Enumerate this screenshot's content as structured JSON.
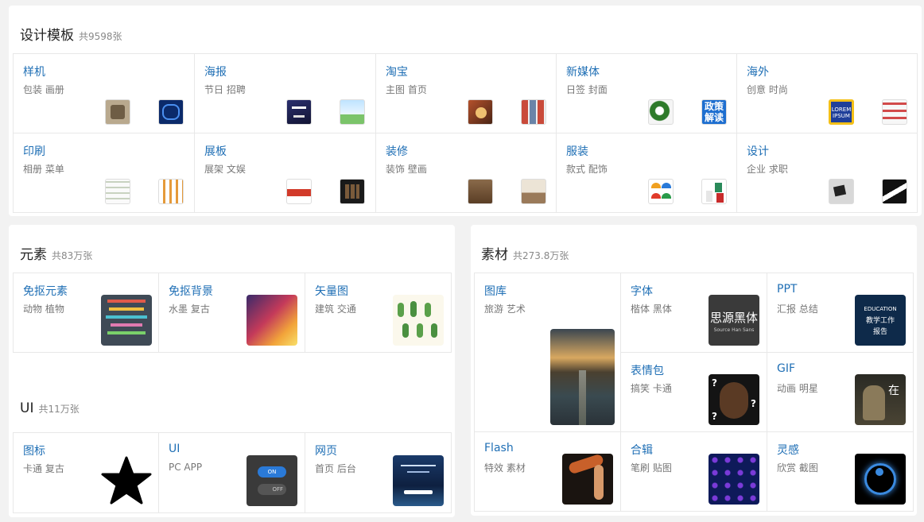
{
  "templates": {
    "title": "设计模板",
    "count": "共9598张",
    "cells": [
      {
        "name": "样机",
        "tags": "包装 画册",
        "thumbs": [
          "mockup-stamp-icon",
          "box-blue-icon"
        ]
      },
      {
        "name": "海报",
        "tags": "节日 招聘",
        "thumbs": [
          "poster-dark-icon",
          "poster-paper-plane-icon"
        ]
      },
      {
        "name": "淘宝",
        "tags": "主图 首页",
        "thumbs": [
          "taobao-food-icon",
          "taobao-collage-icon"
        ]
      },
      {
        "name": "新媒体",
        "tags": "日签 封面",
        "thumbs": [
          "flower-icon",
          "policy-cover-icon"
        ]
      },
      {
        "name": "海外",
        "tags": "创意 时尚",
        "thumbs": [
          "lorem-ipsum-icon",
          "fashion-icon"
        ]
      },
      {
        "name": "印刷",
        "tags": "相册 菜单",
        "thumbs": [
          "brochure-icon",
          "menu-icon"
        ]
      },
      {
        "name": "展板",
        "tags": "展架 文娱",
        "thumbs": [
          "exhibit-board-icon",
          "board-dark-icon"
        ]
      },
      {
        "name": "装修",
        "tags": "装饰 壁画",
        "thumbs": [
          "room-wood-icon",
          "room-interior-icon"
        ]
      },
      {
        "name": "服装",
        "tags": "款式 配饰",
        "thumbs": [
          "umbrella-icon",
          "clothing-icon"
        ]
      },
      {
        "name": "设计",
        "tags": "企业 求职",
        "thumbs": [
          "business-card-icon",
          "resume-icon"
        ]
      }
    ],
    "policy_text": "政策解读",
    "lorem_text": "LOREM IPSUM"
  },
  "elements": {
    "title": "元素",
    "count": "共83万张",
    "cells": [
      {
        "name": "免抠元素",
        "tags": "动物 植物",
        "image": "ribbons-icon"
      },
      {
        "name": "免抠背景",
        "tags": "水墨 复古",
        "image": "gradient-bg-icon"
      },
      {
        "name": "矢量图",
        "tags": "建筑 交通",
        "image": "cactus-icon"
      }
    ]
  },
  "ui": {
    "title": "UI",
    "count": "共11万张",
    "cells": [
      {
        "name": "图标",
        "tags": "卡通 复古",
        "image": "star-icon"
      },
      {
        "name": "UI",
        "tags": "PC APP",
        "image": "toggle-switch-icon"
      },
      {
        "name": "网页",
        "tags": "首页 后台",
        "image": "webpage-icon"
      }
    ],
    "toggle_on": "ON",
    "toggle_off": "OFF"
  },
  "materials": {
    "title": "素材",
    "count": "共273.8万张",
    "cells": [
      {
        "name": "图库",
        "tags": "旅游 艺术",
        "image": "railway-photo-icon"
      },
      {
        "name": "字体",
        "tags": "楷体 黑体",
        "image": "font-sample-icon"
      },
      {
        "name": "PPT",
        "tags": "汇报 总结",
        "image": "ppt-cover-icon"
      },
      {
        "name": "表情包",
        "tags": "搞笑 卡通",
        "image": "meme-face-icon"
      },
      {
        "name": "GIF",
        "tags": "动画 明星",
        "image": "gif-monkey-icon"
      },
      {
        "name": "Flash",
        "tags": "特效 素材",
        "image": "flash-girl-icon"
      },
      {
        "name": "合辑",
        "tags": "笔刷 贴图",
        "image": "collection-grid-icon"
      },
      {
        "name": "灵感",
        "tags": "欣赏 截图",
        "image": "inspiration-yinyang-icon"
      }
    ],
    "font_sample_main": "思源黑体",
    "font_sample_sub": "Source Han Sans",
    "ppt_line1": "EDUCATION",
    "ppt_line2": "教学工作",
    "ppt_line3": "报告",
    "gif_char": "在"
  },
  "colors": {
    "link": "#1f6fb5",
    "tag": "#777777",
    "border": "#e8e8e8",
    "page_bg": "#f2f2f2"
  }
}
